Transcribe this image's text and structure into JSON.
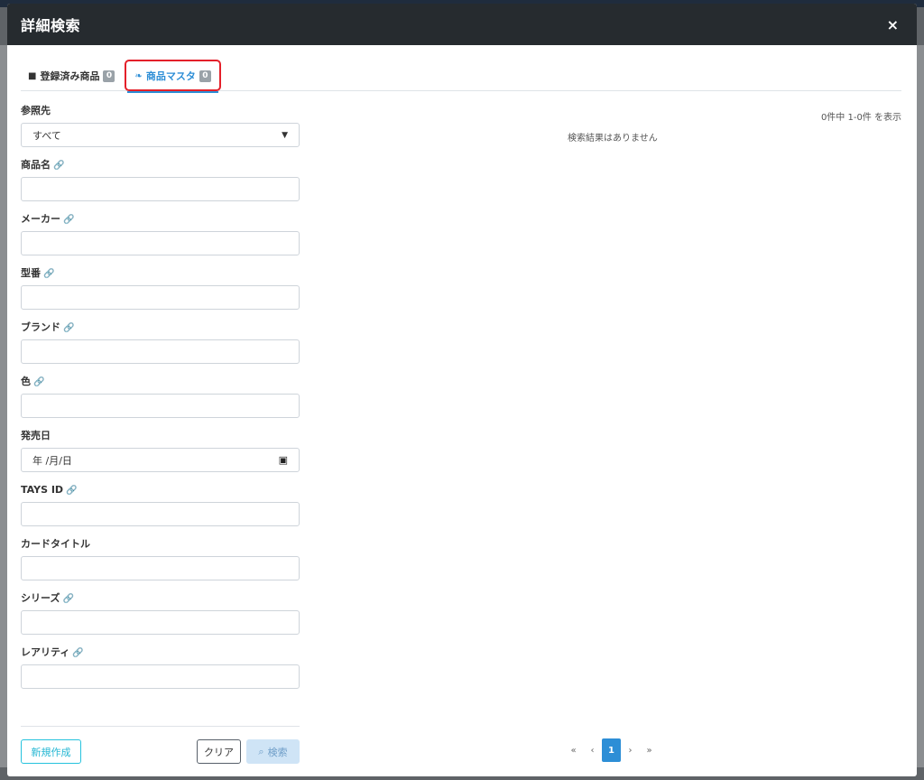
{
  "modal": {
    "title": "詳細検索",
    "close": "×"
  },
  "tabs": [
    {
      "label": "登録済み商品",
      "badge": "0",
      "icon": "cube-icon"
    },
    {
      "label": "商品マスタ",
      "badge": "0",
      "icon": "leaf-icon"
    }
  ],
  "form": {
    "reference": {
      "label": "参照先",
      "value": "すべて"
    },
    "product_name": {
      "label": "商品名"
    },
    "maker": {
      "label": "メーカー"
    },
    "model": {
      "label": "型番"
    },
    "brand": {
      "label": "ブランド"
    },
    "color": {
      "label": "色"
    },
    "release_date": {
      "label": "発売日",
      "placeholder": "年 /月/日"
    },
    "tays_id": {
      "label": "TAYS ID"
    },
    "card_title": {
      "label": "カードタイトル"
    },
    "series": {
      "label": "シリーズ"
    },
    "rarity": {
      "label": "レアリティ"
    }
  },
  "buttons": {
    "new": "新規作成",
    "clear": "クリア",
    "search": "検索"
  },
  "results": {
    "count_text": "0件中 1-0件 を表示",
    "empty_text": "検索結果はありません"
  },
  "pagination": {
    "first": "«",
    "prev": "‹",
    "current": "1",
    "next": "›",
    "last": "»"
  },
  "colors": {
    "accent": "#2d8ed6",
    "highlight": "#e4202a",
    "header": "#262b2f"
  }
}
